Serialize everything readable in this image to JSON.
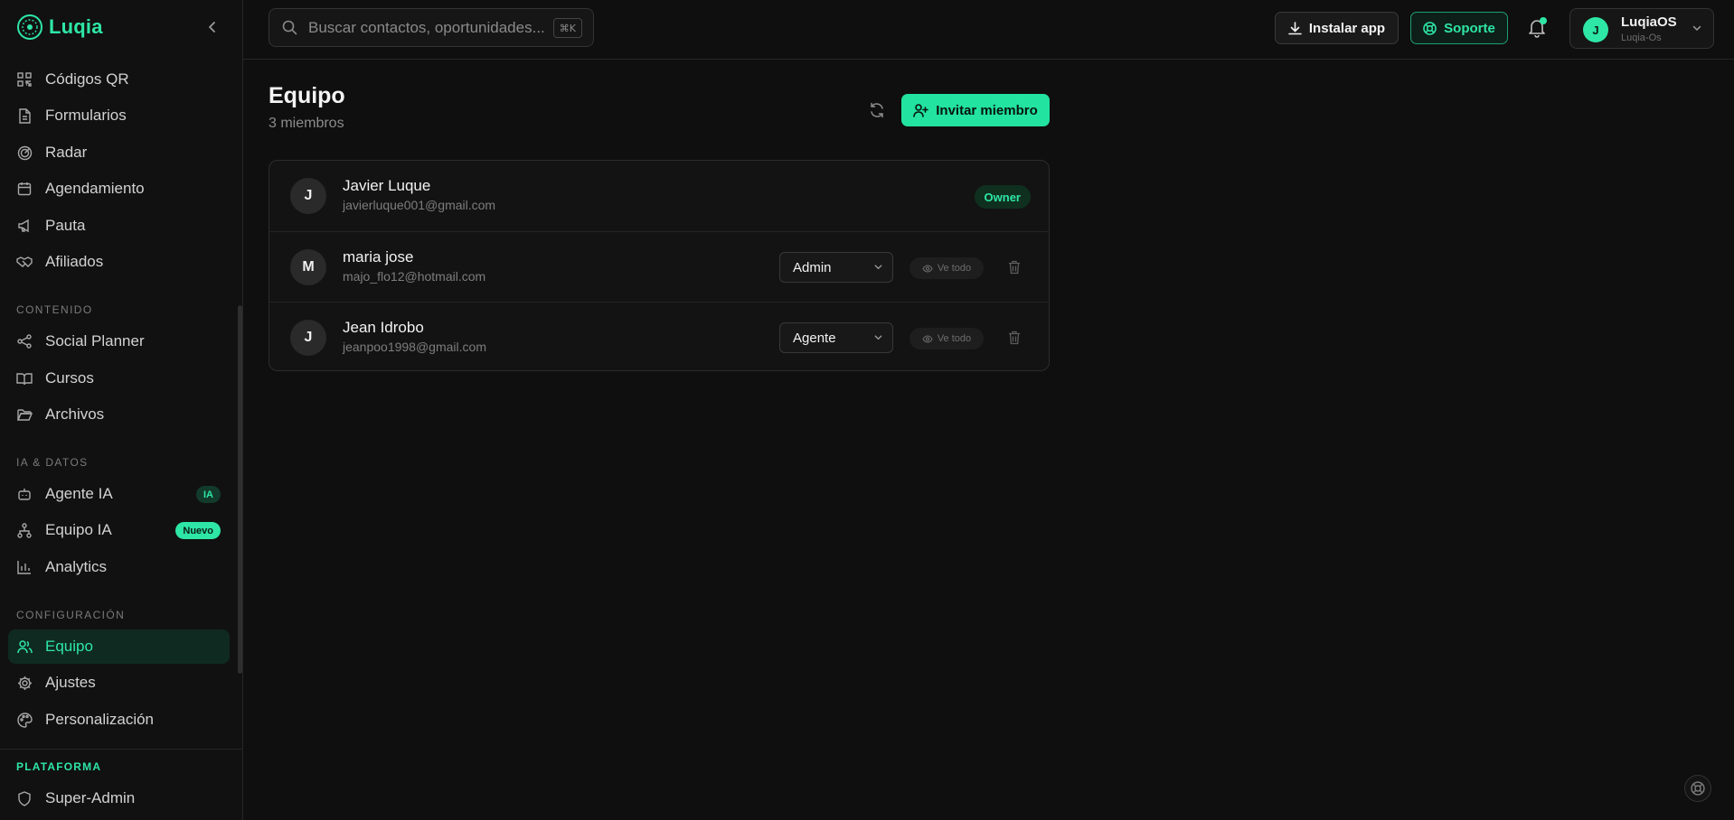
{
  "brand": {
    "name": "Luqia"
  },
  "sidebar": {
    "items_top": [
      {
        "label": "Códigos QR",
        "icon": "qr-code-icon"
      },
      {
        "label": "Formularios",
        "icon": "document-icon"
      },
      {
        "label": "Radar",
        "icon": "radar-icon"
      },
      {
        "label": "Agendamiento",
        "icon": "calendar-icon"
      },
      {
        "label": "Pauta",
        "icon": "megaphone-icon"
      },
      {
        "label": "Afiliados",
        "icon": "handshake-icon"
      }
    ],
    "sections": {
      "contenido": "CONTENIDO",
      "ia_datos": "IA & DATOS",
      "configuracion": "CONFIGURACIÓN",
      "plataforma": "PLATAFORMA"
    },
    "contenido_items": [
      {
        "label": "Social Planner",
        "icon": "share-icon"
      },
      {
        "label": "Cursos",
        "icon": "book-icon"
      },
      {
        "label": "Archivos",
        "icon": "folder-icon"
      }
    ],
    "ia_items": [
      {
        "label": "Agente IA",
        "icon": "bot-icon",
        "badge": "IA"
      },
      {
        "label": "Equipo IA",
        "icon": "network-icon",
        "badge": "Nuevo"
      },
      {
        "label": "Analytics",
        "icon": "bar-chart-icon"
      }
    ],
    "config_items": [
      {
        "label": "Equipo",
        "icon": "users-icon",
        "active": true
      },
      {
        "label": "Ajustes",
        "icon": "gear-icon"
      },
      {
        "label": "Personalización",
        "icon": "palette-icon"
      }
    ],
    "plataforma_items": [
      {
        "label": "Super-Admin",
        "icon": "shield-icon"
      }
    ]
  },
  "topbar": {
    "search_placeholder": "Buscar contactos, oportunidades...",
    "search_shortcut": "⌘K",
    "install_label": "Instalar app",
    "support_label": "Soporte",
    "account": {
      "initial": "J",
      "name": "LuqiaOS",
      "sub": "Luqia-Os"
    }
  },
  "page": {
    "title": "Equipo",
    "subtitle": "3 miembros",
    "invite_label": "Invitar miembro"
  },
  "members": [
    {
      "initial": "J",
      "name": "Javier Luque",
      "email": "javierluque001@gmail.com",
      "badge": "Owner"
    },
    {
      "initial": "M",
      "name": "maria jose",
      "email": "majo_flo12@hotmail.com",
      "role": "Admin",
      "view_label": "Ve todo"
    },
    {
      "initial": "J",
      "name": "Jean Idrobo",
      "email": "jeanpoo1998@gmail.com",
      "role": "Agente",
      "view_label": "Ve todo"
    }
  ],
  "colors": {
    "accent": "#2ee6a6",
    "background": "#0f0f0f",
    "sidebar": "#111111",
    "card": "#131313"
  }
}
